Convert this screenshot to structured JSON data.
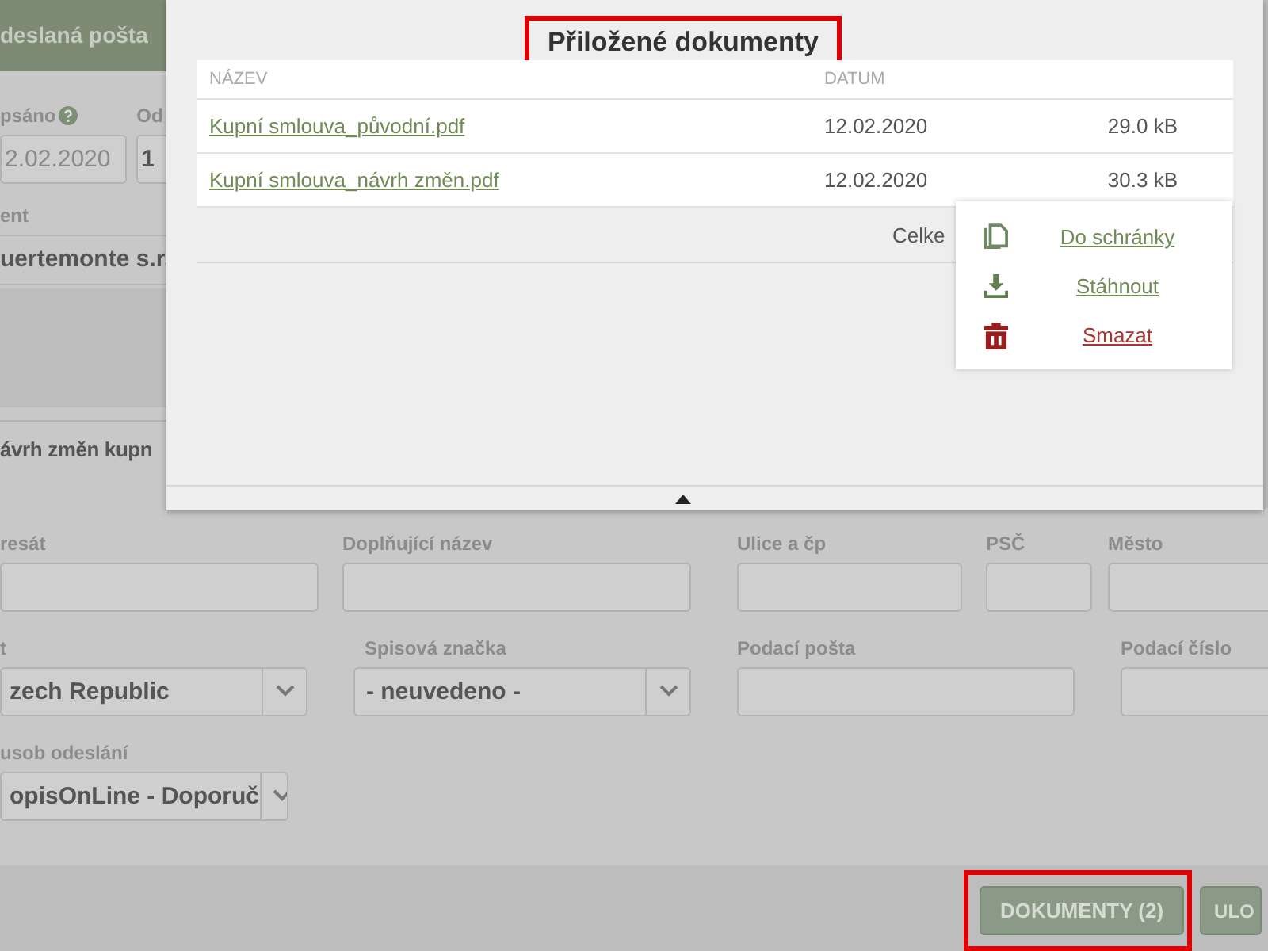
{
  "form": {
    "title": "deslaná pošta",
    "date_field": {
      "label": "psáno",
      "value": "2.02.2020",
      "disabled": true
    },
    "from_field": {
      "label": "Od",
      "value": "1"
    },
    "client_field": {
      "label": "ent",
      "value": "uertemonte s.r."
    },
    "subject": "ávrh změn kupn",
    "fields": [
      {
        "label": "resát",
        "kind": "input"
      },
      {
        "label": "Doplňující název",
        "kind": "input"
      },
      {
        "label": "Ulice a čp",
        "kind": "input"
      },
      {
        "label": "PSČ",
        "kind": "input"
      },
      {
        "label": "Město",
        "kind": "input"
      },
      {
        "label": "t",
        "kind": "select",
        "value": "zech Republic"
      },
      {
        "label": "Spisová značka",
        "kind": "select",
        "value": "- neuvedeno -"
      },
      {
        "label": "Podací pošta",
        "kind": "input"
      },
      {
        "label": "Podací číslo",
        "kind": "input"
      },
      {
        "label": "usob odeslání",
        "kind": "select",
        "value": "opisOnLine - Doporuč"
      }
    ]
  },
  "buttons": [
    {
      "label": "DOKUMENTY (2)",
      "highlighted": true
    },
    {
      "label": "ULO",
      "highlighted": false
    }
  ],
  "modal": {
    "title": "Přiložené dokumenty",
    "highlighted": true,
    "columns": [
      "NÁZEV",
      "DATUM"
    ],
    "rows": [
      {
        "name": "Kupní smlouva_původní.pdf",
        "date": "12.02.2020",
        "size": "29.0 kB"
      },
      {
        "name": "Kupní smlouva_návrh změn.pdf",
        "date": "12.02.2020",
        "size": "30.3 kB"
      }
    ],
    "total": "Celke",
    "context_menu": [
      {
        "label": "Do schránky",
        "kind": "copy"
      },
      {
        "label": "Stáhnout",
        "kind": "download"
      },
      {
        "label": "Smazat",
        "kind": "delete"
      }
    ]
  }
}
